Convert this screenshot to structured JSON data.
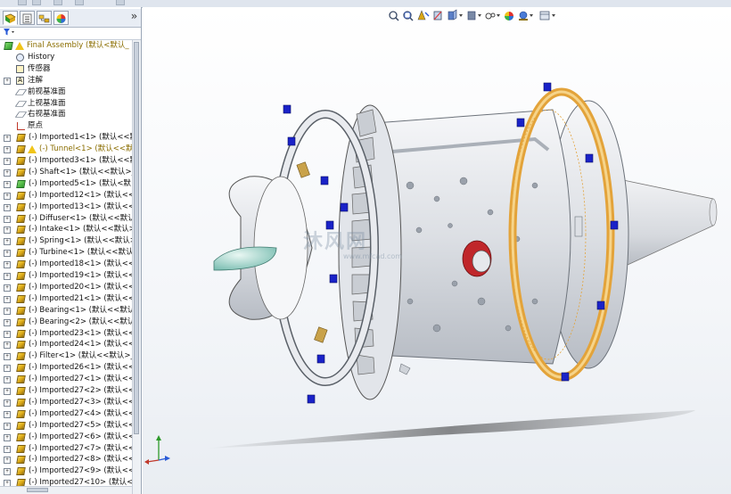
{
  "panel": {
    "tabs": [
      "feature-manager",
      "property-manager",
      "configuration-manager",
      "appearance-manager"
    ],
    "expand_glyph": "»",
    "filter_icon": "filter-icon",
    "tree": [
      {
        "label": "Final Assembly  (默认<默认_",
        "icon": "assembly",
        "exp": false,
        "highlight": true
      },
      {
        "label": "History",
        "icon": "history"
      },
      {
        "label": "传感器",
        "icon": "sensor"
      },
      {
        "label": "注解",
        "icon": "annotation",
        "exp": true
      },
      {
        "label": "前视基准面",
        "icon": "plane"
      },
      {
        "label": "上视基准面",
        "icon": "plane"
      },
      {
        "label": "右视基准面",
        "icon": "plane"
      },
      {
        "label": "原点",
        "icon": "origin"
      },
      {
        "label": "(-) Imported1<1> (默认<<默",
        "icon": "part",
        "exp": true
      },
      {
        "label": "(-) Tunnel<1> (默认<<默认",
        "icon": "part-warn",
        "exp": true,
        "highlight": true
      },
      {
        "label": "(-) Imported3<1> (默认<<默",
        "icon": "part",
        "exp": true
      },
      {
        "label": "(-) Shaft<1> (默认<<默认>_",
        "icon": "part",
        "exp": true
      },
      {
        "label": "(-) Imported5<1> (默认<默",
        "icon": "part-green",
        "exp": true
      },
      {
        "label": "(-) Imported12<1> (默认<<",
        "icon": "part",
        "exp": true
      },
      {
        "label": "(-) Imported13<1> (默认<<",
        "icon": "part",
        "exp": true
      },
      {
        "label": "(-) Diffuser<1> (默认<<默认",
        "icon": "part",
        "exp": true
      },
      {
        "label": "(-) Intake<1> (默认<<默认>",
        "icon": "part",
        "exp": true
      },
      {
        "label": "(-) Spring<1> (默认<<默认>",
        "icon": "part",
        "exp": true
      },
      {
        "label": "(-) Turbine<1> (默认<<默认",
        "icon": "part",
        "exp": true
      },
      {
        "label": "(-) Imported18<1> (默认<<",
        "icon": "part",
        "exp": true
      },
      {
        "label": "(-) Imported19<1> (默认<<",
        "icon": "part",
        "exp": true
      },
      {
        "label": "(-) Imported20<1> (默认<<",
        "icon": "part",
        "exp": true
      },
      {
        "label": "(-) Imported21<1> (默认<<",
        "icon": "part",
        "exp": true
      },
      {
        "label": "(-) Bearing<1> (默认<<默认",
        "icon": "part",
        "exp": true
      },
      {
        "label": "(-) Bearing<2> (默认<<默认",
        "icon": "part",
        "exp": true
      },
      {
        "label": "(-) Imported23<1> (默认<<",
        "icon": "part",
        "exp": true
      },
      {
        "label": "(-) Imported24<1> (默认<<",
        "icon": "part",
        "exp": true
      },
      {
        "label": "(-) Filter<1> (默认<<默认>_",
        "icon": "part",
        "exp": true
      },
      {
        "label": "(-) Imported26<1> (默认<<",
        "icon": "part",
        "exp": true
      },
      {
        "label": "(-) Imported27<1> (默认<<",
        "icon": "part",
        "exp": true
      },
      {
        "label": "(-) Imported27<2> (默认<<",
        "icon": "part",
        "exp": true
      },
      {
        "label": "(-) Imported27<3> (默认<<",
        "icon": "part",
        "exp": true
      },
      {
        "label": "(-) Imported27<4> (默认<<",
        "icon": "part",
        "exp": true
      },
      {
        "label": "(-) Imported27<5> (默认<<",
        "icon": "part",
        "exp": true
      },
      {
        "label": "(-) Imported27<6> (默认<<",
        "icon": "part",
        "exp": true
      },
      {
        "label": "(-) Imported27<7> (默认<<",
        "icon": "part",
        "exp": true
      },
      {
        "label": "(-) Imported27<8> (默认<<",
        "icon": "part",
        "exp": true
      },
      {
        "label": "(-) Imported27<9> (默认<<",
        "icon": "part",
        "exp": true
      },
      {
        "label": "(-) Imported27<10> (默认<<",
        "icon": "part",
        "exp": true
      }
    ]
  },
  "viewport": {
    "heads_up_icons": [
      "zoom-to-fit-icon",
      "zoom-area-icon",
      "previous-view-icon",
      "section-view-icon",
      "view-orientation-icon",
      "display-style-icon",
      "hide-show-icon",
      "edit-appearance-icon",
      "apply-scene-icon",
      "view-settings-icon"
    ],
    "watermark": "沐风网",
    "watermark_url": "www.mfcad.com",
    "model": "turbojet-engine-assembly",
    "colors": {
      "casing": "#dcdfe4",
      "bolts": "#1a22c8",
      "selected_ring": "#e3a33a",
      "nose_cone": "#9fd3c9",
      "red_part": "#c0262a"
    }
  }
}
